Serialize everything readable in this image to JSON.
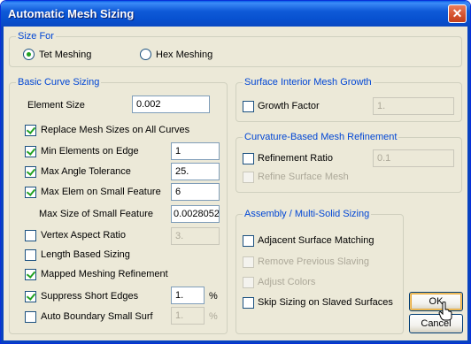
{
  "window": {
    "title": "Automatic Mesh Sizing",
    "close_glyph": "✕"
  },
  "size_for": {
    "label": "Size For",
    "options": [
      {
        "label": "Tet Meshing",
        "selected": true
      },
      {
        "label": "Hex Meshing",
        "selected": false
      }
    ]
  },
  "basic_curve_sizing": {
    "label": "Basic Curve Sizing",
    "element_size": {
      "label": "Element Size",
      "value": "0.002"
    },
    "replace_mesh_sizes": {
      "label": "Replace Mesh Sizes on All Curves",
      "checked": true
    },
    "min_elements_on_edge": {
      "label": "Min Elements on Edge",
      "checked": true,
      "value": "1"
    },
    "max_angle_tolerance": {
      "label": "Max Angle Tolerance",
      "checked": true,
      "value": "25."
    },
    "max_elem_on_small_feature": {
      "label": "Max Elem on Small Feature",
      "checked": true,
      "value": "6"
    },
    "max_size_small_feature": {
      "label": "Max Size of Small Feature",
      "value": "0.0028052"
    },
    "vertex_aspect_ratio": {
      "label": "Vertex Aspect Ratio",
      "checked": false,
      "value": "3."
    },
    "length_based_sizing": {
      "label": "Length Based Sizing",
      "checked": false
    },
    "mapped_meshing_refinement": {
      "label": "Mapped Meshing Refinement",
      "checked": true
    },
    "suppress_short_edges": {
      "label": "Suppress Short Edges",
      "checked": true,
      "value": "1.",
      "unit": "%"
    },
    "auto_boundary_small_surf": {
      "label": "Auto Boundary Small Surf",
      "checked": false,
      "value": "1.",
      "unit": "%"
    }
  },
  "surface_interior": {
    "label": "Surface Interior Mesh Growth",
    "growth_factor": {
      "label": "Growth  Factor",
      "checked": false,
      "value": "1."
    }
  },
  "curvature_refinement": {
    "label": "Curvature-Based Mesh Refinement",
    "refinement_ratio": {
      "label": "Refinement Ratio",
      "checked": false,
      "value": "0.1"
    },
    "refine_surface_mesh": {
      "label": "Refine Surface Mesh",
      "checked": false
    }
  },
  "assembly": {
    "label": "Assembly / Multi-Solid Sizing",
    "adjacent_surface_matching": {
      "label": "Adjacent Surface Matching",
      "checked": false
    },
    "remove_previous_slaving": {
      "label": "Remove Previous Slaving",
      "checked": false
    },
    "adjust_colors": {
      "label": "Adjust Colors",
      "checked": false
    },
    "skip_sizing_slaved": {
      "label": "Skip Sizing on Slaved Surfaces",
      "checked": false
    }
  },
  "buttons": {
    "ok": "OK",
    "cancel": "Cancel"
  }
}
